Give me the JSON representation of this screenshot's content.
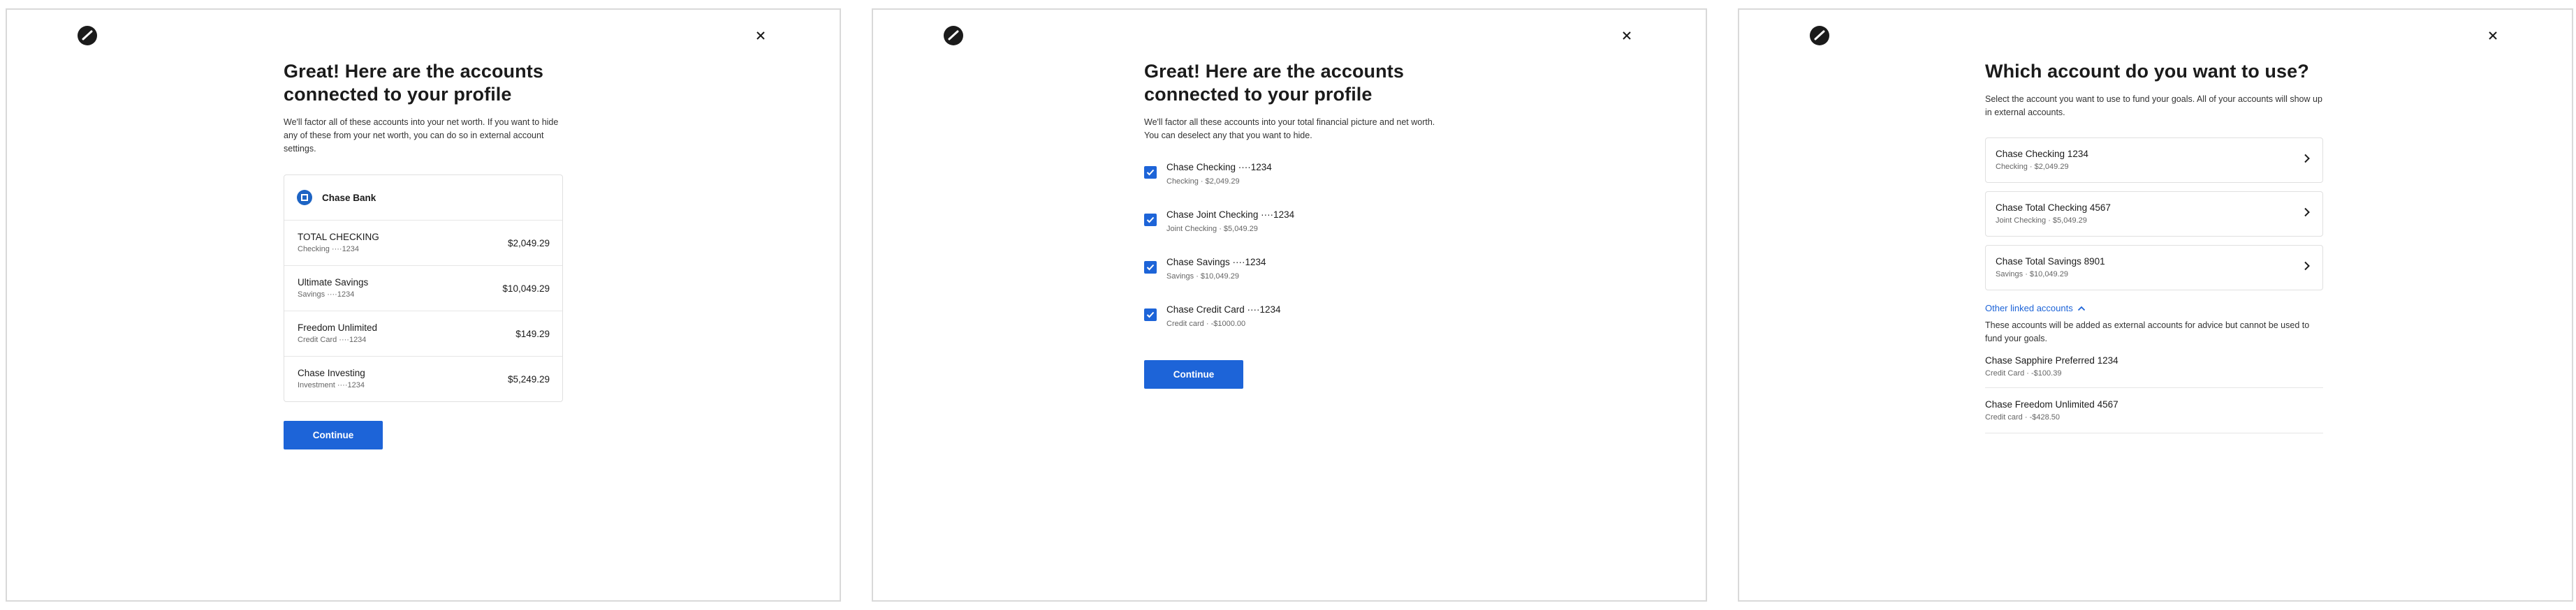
{
  "panel1": {
    "title": "Great! Here are the accounts connected to your profile",
    "subtitle": "We'll factor all of these accounts into your net worth. If you want to hide any of these from your net worth, you can do so in external account settings.",
    "bank_name": "Chase Bank",
    "accounts": [
      {
        "name": "TOTAL CHECKING",
        "detail": "Checking ····1234",
        "amount": "$2,049.29"
      },
      {
        "name": "Ultimate Savings",
        "detail": "Savings ····1234",
        "amount": "$10,049.29"
      },
      {
        "name": "Freedom Unlimited",
        "detail": "Credit Card ····1234",
        "amount": "$149.29"
      },
      {
        "name": "Chase Investing",
        "detail": "Investment ····1234",
        "amount": "$5,249.29"
      }
    ],
    "continue_label": "Continue"
  },
  "panel2": {
    "title": "Great! Here are the accounts connected to your profile",
    "subtitle": "We'll factor all these accounts into your total financial picture and net worth. You can deselect any that you want to hide.",
    "accounts": [
      {
        "name": "Chase Checking ····1234",
        "detail": "Checking · $2,049.29",
        "checked": true
      },
      {
        "name": "Chase Joint Checking ····1234",
        "detail": "Joint Checking · $5,049.29",
        "checked": true
      },
      {
        "name": "Chase Savings ····1234",
        "detail": "Savings · $10,049.29",
        "checked": true
      },
      {
        "name": "Chase Credit Card ····1234",
        "detail": "Credit card · -$1000.00",
        "checked": true
      }
    ],
    "continue_label": "Continue"
  },
  "panel3": {
    "title": "Which account do you want to use?",
    "subtitle": "Select the account you want to use to fund your goals. All of your accounts will show up in external accounts.",
    "accounts": [
      {
        "name": "Chase Checking 1234",
        "detail": "Checking · $2,049.29"
      },
      {
        "name": "Chase Total Checking 4567",
        "detail": "Joint Checking · $5,049.29"
      },
      {
        "name": "Chase Total Savings 8901",
        "detail": "Savings · $10,049.29"
      }
    ],
    "other_link_label": "Other linked accounts",
    "other_desc": "These accounts will be added as external accounts for advice but cannot be used to fund your goals.",
    "linked_accounts": [
      {
        "name": "Chase Sapphire Preferred 1234",
        "detail": "Credit Card · -$100.39"
      },
      {
        "name": "Chase Freedom Unlimited 4567",
        "detail": "Credit card · -$428.50"
      }
    ]
  },
  "colors": {
    "accent": "#1d64d8",
    "bank_logo": "#1d64c4",
    "border": "#d9d9d9"
  },
  "icons": [
    "brand-logo-icon",
    "close-icon",
    "chase-logo-icon",
    "checkbox-checked-icon",
    "chevron-right-icon",
    "chevron-up-icon"
  ]
}
